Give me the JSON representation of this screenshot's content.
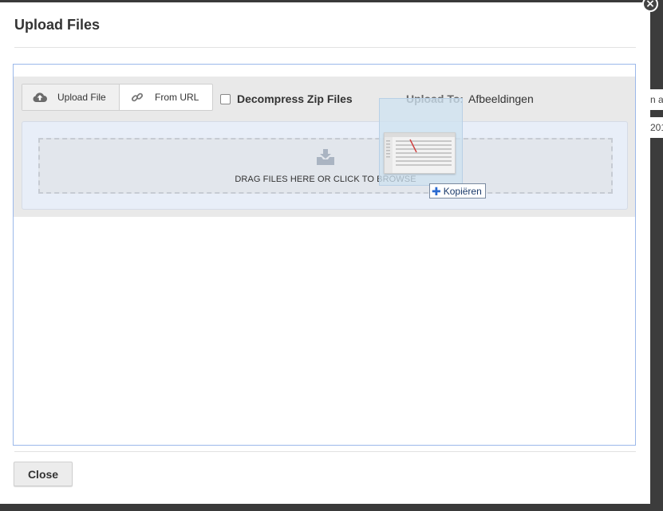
{
  "dialog": {
    "title": "Upload Files",
    "close_label": "Close"
  },
  "toolbar": {
    "upload_file_label": "Upload File",
    "from_url_label": "From URL",
    "decompress_label": "Decompress Zip Files",
    "decompress_checked": false,
    "upload_to_label": "Upload To:",
    "upload_to_value": "Afbeeldingen"
  },
  "dropzone": {
    "text": "DRAG FILES HERE OR CLICK TO BROWSE",
    "icon": "download-tray-icon"
  },
  "drag": {
    "copy_label": "Kopiëren"
  },
  "background_peek": {
    "text1": "n a",
    "text2": "201"
  },
  "icons": {
    "upload": "cloud-upload-icon",
    "url": "link-icon",
    "close": "close-icon"
  },
  "colors": {
    "frame_border": "#9bb8ea",
    "dropzone_bg": "#e8eef8",
    "accent": "#2a6ad0"
  }
}
